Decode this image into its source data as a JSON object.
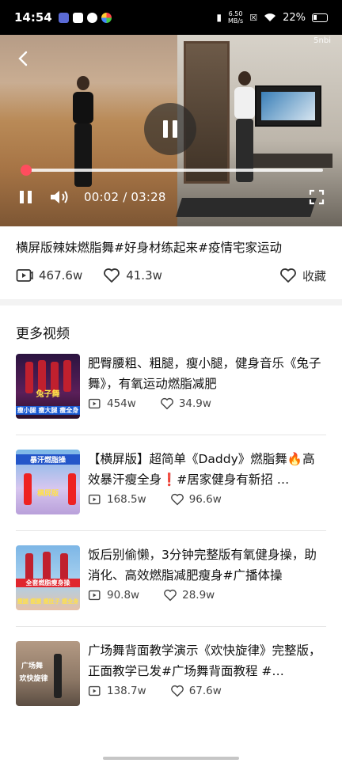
{
  "status_bar": {
    "time": "14:54",
    "net_speed_value": "6.50",
    "net_speed_unit": "MB/s",
    "battery": "22%"
  },
  "player": {
    "watermark": "5nbi",
    "current_time": "00:02",
    "total_time": "03:28",
    "timecode": "00:02 / 03:28",
    "progress_fraction": 0.01,
    "accent_color": "#ff4d5e"
  },
  "video": {
    "title": "横屏版辣妹燃脂舞#好身材练起来#疫情宅家运动",
    "plays": "467.6w",
    "likes": "41.3w",
    "favorite_label": "收藏"
  },
  "more": {
    "section_title": "更多视频",
    "items": [
      {
        "title": "肥臀腰粗、粗腿，瘦小腿，健身音乐《兔子舞》，有氧运动燃脂减肥",
        "plays": "454w",
        "likes": "34.9w",
        "thumb_text": "兔子舞",
        "thumb_sub": "瘦小腿 瘦大腿 瘦全身"
      },
      {
        "title": "【横屏版】超简单《Daddy》燃脂舞🔥高效暴汗瘦全身❗#居家健身有新招 …",
        "plays": "168.5w",
        "likes": "96.6w",
        "thumb_text": "暴汗燃脂操",
        "thumb_sub": "横屏版"
      },
      {
        "title": "饭后别偷懒，3分钟完整版有氧健身操，助消化、高效燃脂减肥瘦身#广播体操",
        "plays": "90.8w",
        "likes": "28.9w",
        "thumb_text": "全套燃脂瘦身操",
        "thumb_sub": "瘦腿 瘦腰 瘦肚子 瘦全身"
      },
      {
        "title": "广场舞背面教学演示《欢快旋律》完整版，正面教学已发#广场舞背面教程 #…",
        "plays": "138.7w",
        "likes": "67.6w",
        "thumb_text": "广场舞",
        "thumb_sub": "欢快旋律"
      }
    ]
  }
}
